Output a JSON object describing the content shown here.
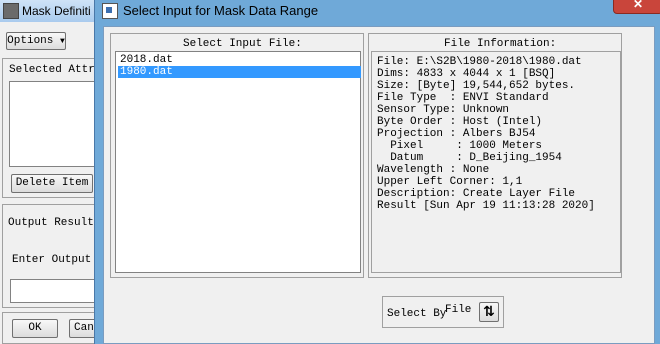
{
  "background_window": {
    "title": "Mask Definiti",
    "options_label": "Options",
    "selected_attr_label": "Selected Attri",
    "delete_item_label": "Delete Item",
    "output_result_label": "Output Result",
    "enter_output_label": "Enter Output F",
    "ok_label": "OK",
    "cancel_label": "Canc"
  },
  "dialog": {
    "title": "Select Input for Mask Data Range",
    "close_glyph": "✕",
    "select_input_file_label": "Select Input File:",
    "files": [
      "2018.dat",
      "1980.dat"
    ],
    "selected_file": "1980.dat",
    "file_information_label": "File Information:",
    "info_lines": [
      "File: E:\\S2B\\1980-2018\\1980.dat",
      "Dims: 4833 x 4044 x 1 [BSQ]",
      "Size: [Byte] 19,544,652 bytes.",
      "File Type  : ENVI Standard",
      "Sensor Type: Unknown",
      "Byte Order : Host (Intel)",
      "Projection : Albers BJ54",
      "  Pixel     : 1000 Meters",
      "  Datum     : D_Beijing_1954",
      "Wavelength : None",
      "Upper Left Corner: 1,1",
      "Description: Create Layer File",
      "Result [Sun Apr 19 11:13:28 2020]"
    ],
    "select_by_label": "Select By",
    "select_by_value": "File",
    "swap_glyph": "⇅"
  }
}
